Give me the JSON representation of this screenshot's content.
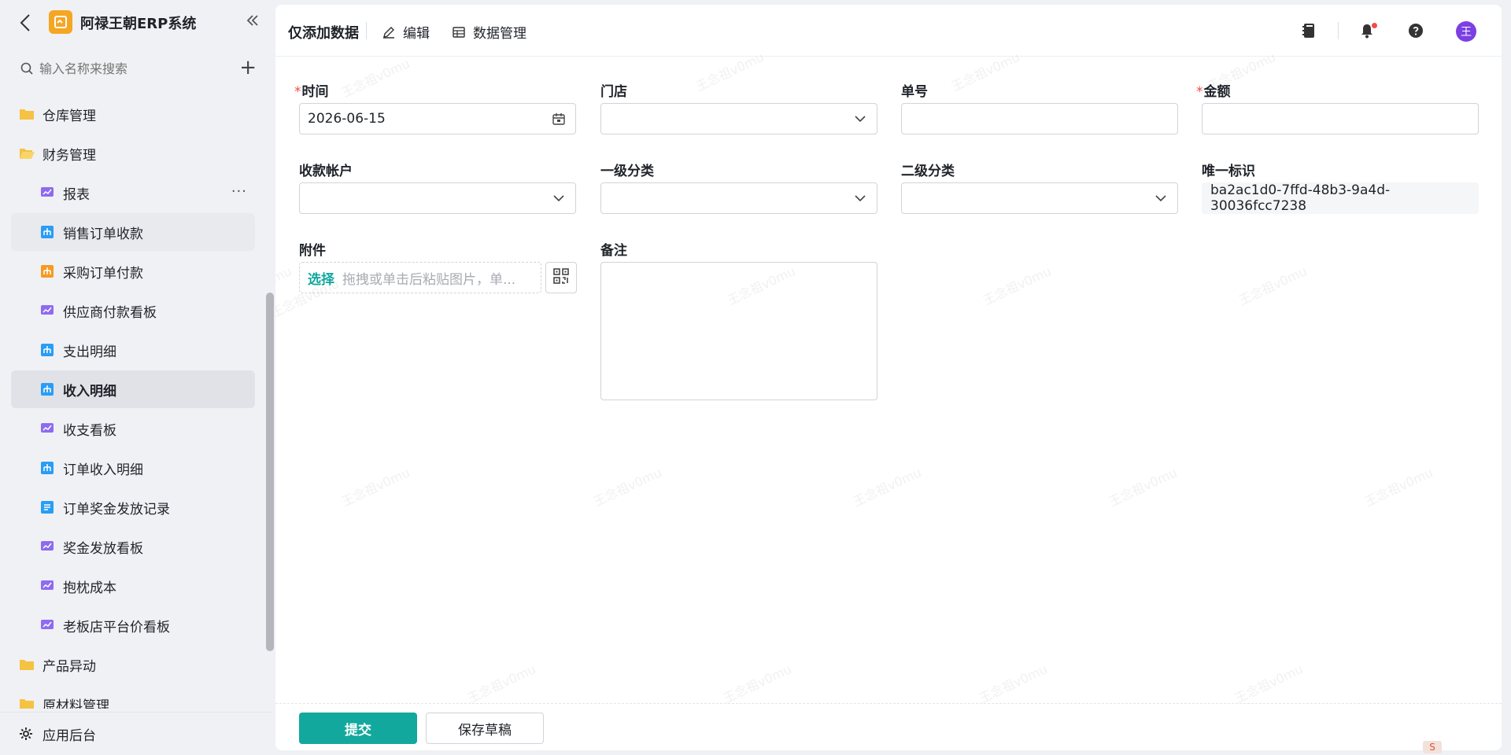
{
  "app": {
    "title": "阿禄王朝ERP系统"
  },
  "sidebar": {
    "search_placeholder": "输入名称来搜索",
    "items": [
      {
        "label": "仓库管理",
        "kind": "folder",
        "icon": "folder-icon"
      },
      {
        "label": "财务管理",
        "kind": "folder-open",
        "icon": "folder-open-icon"
      },
      {
        "label": "报表",
        "kind": "child",
        "icon": "chart-board-icon",
        "more": "···"
      },
      {
        "label": "销售订单收款",
        "kind": "child",
        "icon": "table-icon"
      },
      {
        "label": "采购订单付款",
        "kind": "child",
        "icon": "table-icon"
      },
      {
        "label": "供应商付款看板",
        "kind": "child",
        "icon": "chart-board-icon"
      },
      {
        "label": "支出明细",
        "kind": "child",
        "icon": "table-icon"
      },
      {
        "label": "收入明细",
        "kind": "child",
        "icon": "table-icon",
        "active": true
      },
      {
        "label": "收支看板",
        "kind": "child",
        "icon": "chart-board-icon"
      },
      {
        "label": "订单收入明细",
        "kind": "child",
        "icon": "table-icon"
      },
      {
        "label": "订单奖金发放记录",
        "kind": "child",
        "icon": "form-icon"
      },
      {
        "label": "奖金发放看板",
        "kind": "child",
        "icon": "chart-board-icon"
      },
      {
        "label": "抱枕成本",
        "kind": "child",
        "icon": "chart-board-icon"
      },
      {
        "label": "老板店平台价看板",
        "kind": "child",
        "icon": "chart-board-icon"
      },
      {
        "label": "产品异动",
        "kind": "folder",
        "icon": "folder-icon"
      },
      {
        "label": "原材料管理",
        "kind": "folder",
        "icon": "folder-icon"
      }
    ],
    "bottom_label": "应用后台"
  },
  "topbar": {
    "title": "仅添加数据",
    "edit_label": "编辑",
    "data_manage_label": "数据管理",
    "avatar_text": "王"
  },
  "form": {
    "time_label": "时间",
    "time_value": "2026-06-15",
    "store_label": "门店",
    "order_no_label": "单号",
    "amount_label": "金额",
    "account_label": "收款帐户",
    "category1_label": "一级分类",
    "category2_label": "二级分类",
    "uid_label": "唯一标识",
    "uid_value": "ba2ac1d0-7ffd-48b3-9a4d-30036fcc7238",
    "attachment_label": "附件",
    "attachment_pick": "选择",
    "attachment_hint": "拖拽或单击后粘贴图片，单...",
    "remark_label": "备注",
    "required_mark": "*"
  },
  "footer": {
    "submit_label": "提交",
    "draft_label": "保存草稿"
  },
  "watermark_text": "王念祖v0mu",
  "corner_badge_text": "S",
  "colors": {
    "primary": "#12a89d",
    "required": "#f54a45",
    "avatar": "#7b3fe4",
    "folder": "#f5c242",
    "table_icon": "#2a9df4",
    "table_icon_orange": "#f59a23",
    "chart_icon": "#8e6bf0"
  }
}
